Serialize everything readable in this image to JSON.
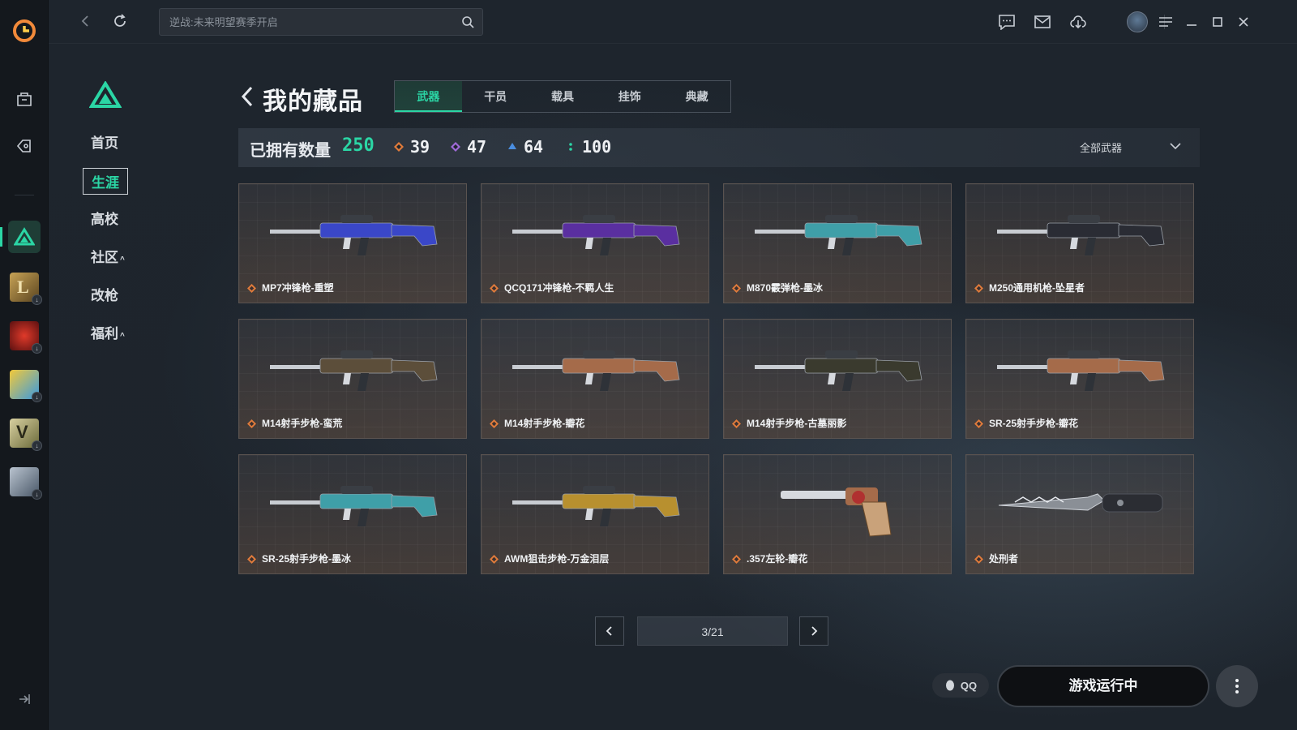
{
  "search": {
    "placeholder": "逆战:未来明望赛季开启"
  },
  "sidebar": {
    "items": [
      {
        "label": "首页"
      },
      {
        "label": "生涯"
      },
      {
        "label": "高校"
      },
      {
        "label": "社区"
      },
      {
        "label": "改枪"
      },
      {
        "label": "福利"
      }
    ],
    "caret": "^"
  },
  "page": {
    "title": "我的藏品"
  },
  "tabs": [
    "武器",
    "干员",
    "载具",
    "挂饰",
    "典藏"
  ],
  "stats": {
    "label": "已拥有数量",
    "total": "250",
    "rarities": [
      {
        "count": "39",
        "color": "#e07b3b"
      },
      {
        "count": "47",
        "color": "#a06ad8"
      },
      {
        "count": "64",
        "color": "#4a8ee0"
      },
      {
        "count": "100",
        "color": "#2bd6a5"
      }
    ],
    "filter": "全部武器"
  },
  "items": [
    {
      "name": "MP7冲锋枪-重塑",
      "rarity_color": "#e07b3b",
      "palette": "#3a47c8"
    },
    {
      "name": "QCQ171冲锋枪-不羁人生",
      "rarity_color": "#e07b3b",
      "palette": "#5a2fa0"
    },
    {
      "name": "M870霰弹枪-墨冰",
      "rarity_color": "#e07b3b",
      "palette": "#3f9fa8"
    },
    {
      "name": "M250通用机枪-坠星者",
      "rarity_color": "#e07b3b",
      "palette": "#2a2c34"
    },
    {
      "name": "M14射手步枪-蛮荒",
      "rarity_color": "#e07b3b",
      "palette": "#5c4e3a"
    },
    {
      "name": "M14射手步枪-瓣花",
      "rarity_color": "#e07b3b",
      "palette": "#a56b4a"
    },
    {
      "name": "M14射手步枪-古墓丽影",
      "rarity_color": "#e07b3b",
      "palette": "#3a3a2e"
    },
    {
      "name": "SR-25射手步枪-瓣花",
      "rarity_color": "#e07b3b",
      "palette": "#a56b4a"
    },
    {
      "name": "SR-25射手步枪-墨冰",
      "rarity_color": "#e07b3b",
      "palette": "#3f9fa8"
    },
    {
      "name": "AWM狙击步枪-万金泪层",
      "rarity_color": "#e07b3b",
      "palette": "#b8902f"
    },
    {
      "name": ".357左轮-瓣花",
      "rarity_color": "#e07b3b",
      "palette": "#a56b4a"
    },
    {
      "name": "处刑者",
      "rarity_color": "#e07b3b",
      "palette": "#8a8f96"
    }
  ],
  "pager": {
    "text": "3/21"
  },
  "footer": {
    "qq_label": "QQ",
    "launch_label": "游戏运行中"
  },
  "colors": {
    "accent": "#2bd6a5",
    "background": "#1d242c"
  }
}
